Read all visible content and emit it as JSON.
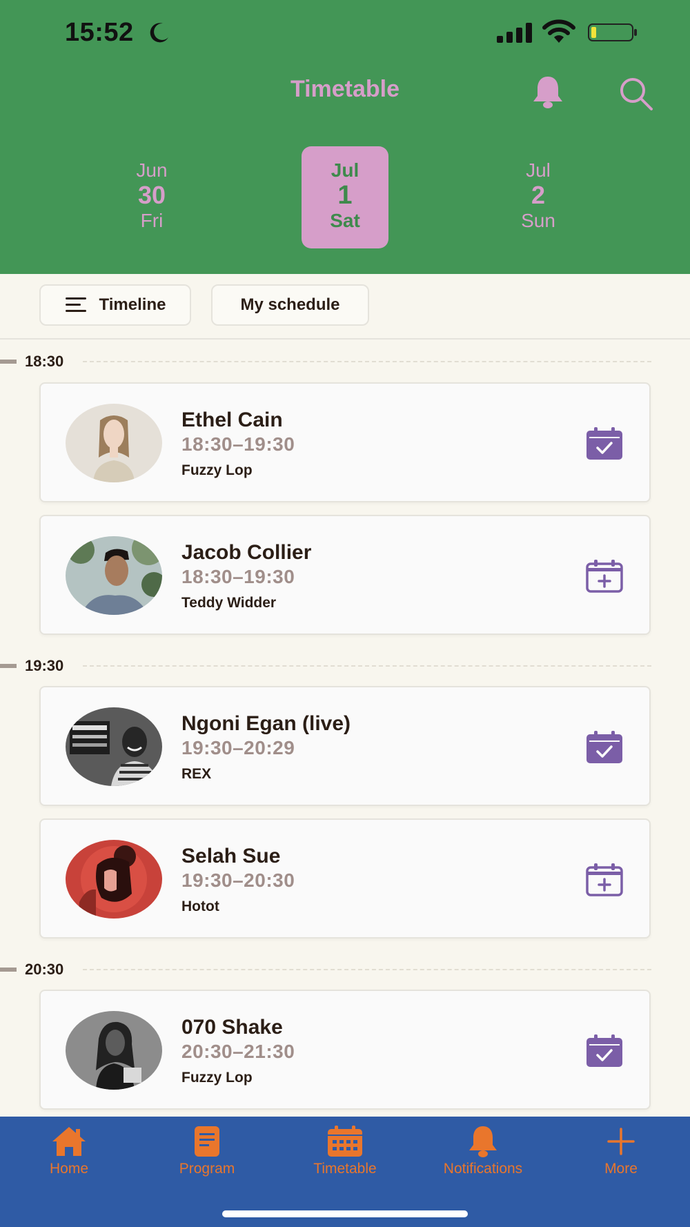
{
  "status_bar": {
    "time": "15:52"
  },
  "header": {
    "title": "Timetable"
  },
  "days": [
    {
      "month": "Jun",
      "day": "30",
      "weekday": "Fri",
      "selected": false
    },
    {
      "month": "Jul",
      "day": "1",
      "weekday": "Sat",
      "selected": true
    },
    {
      "month": "Jul",
      "day": "2",
      "weekday": "Sun",
      "selected": false
    }
  ],
  "view_tabs": {
    "timeline": "Timeline",
    "my_schedule": "My schedule"
  },
  "time_slots": [
    "18:30",
    "19:30",
    "20:30"
  ],
  "acts": [
    {
      "name": "Ethel Cain",
      "time": "18:30–19:30",
      "stage": "Fuzzy Lop",
      "in_schedule": true
    },
    {
      "name": "Jacob Collier",
      "time": "18:30–19:30",
      "stage": "Teddy Widder",
      "in_schedule": false
    },
    {
      "name": "Ngoni Egan (live)",
      "time": "19:30–20:29",
      "stage": "REX",
      "in_schedule": true
    },
    {
      "name": "Selah Sue",
      "time": "19:30–20:30",
      "stage": "Hotot",
      "in_schedule": false
    },
    {
      "name": "070 Shake",
      "time": "20:30–21:30",
      "stage": "Fuzzy Lop",
      "in_schedule": true
    }
  ],
  "tab_bar": {
    "home": "Home",
    "program": "Program",
    "timetable": "Timetable",
    "notifications": "Notifications",
    "more": "More"
  },
  "colors": {
    "header_bg": "#439656",
    "accent_pink": "#d69ec9",
    "calendar_purple": "#7b5ea7",
    "tab_bar_bg": "#2f5ba5",
    "tab_icon": "#e9762c"
  }
}
